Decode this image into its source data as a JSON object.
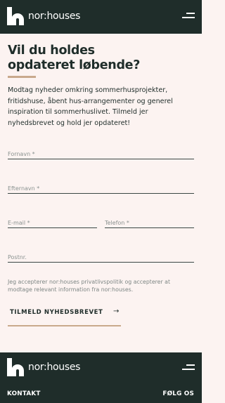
{
  "header": {
    "logo_text": "nor:houses",
    "menu_icon": "hamburger-menu-icon"
  },
  "main": {
    "title_line1": "Vil du holdes",
    "title_line2": "opdateret løbende?",
    "intro": "Modtag nyheder omkring sommerhusprojekter, fritidshuse, åbent hus-arrangementer og generel inspiration til sommerhuslivet. Tilmeld jer nyhedsbrevet og hold jer opdateret!",
    "accent_color": "#c9a98c"
  },
  "form": {
    "fornavn_placeholder": "Fornavn *",
    "efternavn_placeholder": "Efternavn *",
    "email_placeholder": "E-mail *",
    "telefon_placeholder": "Telefon *",
    "postnr_placeholder": "Postnr.",
    "consent": "Jeg accepterer nor:houses privatlivspolitik og accepterer at modtage relevant information fra nor:houses.",
    "submit_label": "TILMELD NYHEDSBREVET",
    "submit_arrow": "→"
  },
  "footer": {
    "logo_text": "nor:houses",
    "left_label": "KONTAKT",
    "right_label": "FØLG OS"
  },
  "colors": {
    "dark": "#1f2d2a",
    "background": "#fcf3f1"
  }
}
